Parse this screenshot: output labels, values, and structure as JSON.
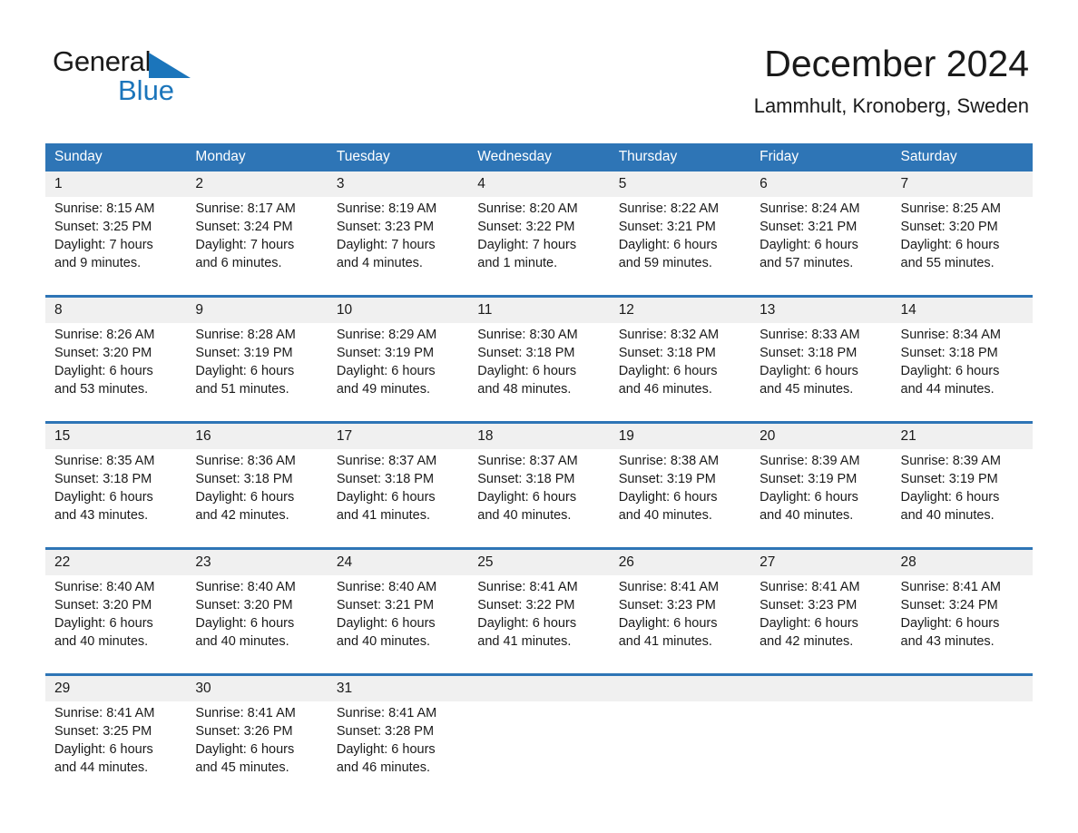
{
  "brand": {
    "name_part1": "General",
    "name_part2": "Blue",
    "accent_color": "#1b75bb",
    "triangle_icon": "blue-triangle-icon"
  },
  "header": {
    "month_title": "December 2024",
    "location": "Lammhult, Kronoberg, Sweden"
  },
  "calendar": {
    "header_color": "#2e75b6",
    "daynum_bg": "#f0f0f0",
    "weekday_headers": [
      "Sunday",
      "Monday",
      "Tuesday",
      "Wednesday",
      "Thursday",
      "Friday",
      "Saturday"
    ],
    "weeks": [
      {
        "days": [
          {
            "num": "1",
            "l1": "Sunrise: 8:15 AM",
            "l2": "Sunset: 3:25 PM",
            "l3": "Daylight: 7 hours",
            "l4": "and 9 minutes."
          },
          {
            "num": "2",
            "l1": "Sunrise: 8:17 AM",
            "l2": "Sunset: 3:24 PM",
            "l3": "Daylight: 7 hours",
            "l4": "and 6 minutes."
          },
          {
            "num": "3",
            "l1": "Sunrise: 8:19 AM",
            "l2": "Sunset: 3:23 PM",
            "l3": "Daylight: 7 hours",
            "l4": "and 4 minutes."
          },
          {
            "num": "4",
            "l1": "Sunrise: 8:20 AM",
            "l2": "Sunset: 3:22 PM",
            "l3": "Daylight: 7 hours",
            "l4": "and 1 minute."
          },
          {
            "num": "5",
            "l1": "Sunrise: 8:22 AM",
            "l2": "Sunset: 3:21 PM",
            "l3": "Daylight: 6 hours",
            "l4": "and 59 minutes."
          },
          {
            "num": "6",
            "l1": "Sunrise: 8:24 AM",
            "l2": "Sunset: 3:21 PM",
            "l3": "Daylight: 6 hours",
            "l4": "and 57 minutes."
          },
          {
            "num": "7",
            "l1": "Sunrise: 8:25 AM",
            "l2": "Sunset: 3:20 PM",
            "l3": "Daylight: 6 hours",
            "l4": "and 55 minutes."
          }
        ]
      },
      {
        "days": [
          {
            "num": "8",
            "l1": "Sunrise: 8:26 AM",
            "l2": "Sunset: 3:20 PM",
            "l3": "Daylight: 6 hours",
            "l4": "and 53 minutes."
          },
          {
            "num": "9",
            "l1": "Sunrise: 8:28 AM",
            "l2": "Sunset: 3:19 PM",
            "l3": "Daylight: 6 hours",
            "l4": "and 51 minutes."
          },
          {
            "num": "10",
            "l1": "Sunrise: 8:29 AM",
            "l2": "Sunset: 3:19 PM",
            "l3": "Daylight: 6 hours",
            "l4": "and 49 minutes."
          },
          {
            "num": "11",
            "l1": "Sunrise: 8:30 AM",
            "l2": "Sunset: 3:18 PM",
            "l3": "Daylight: 6 hours",
            "l4": "and 48 minutes."
          },
          {
            "num": "12",
            "l1": "Sunrise: 8:32 AM",
            "l2": "Sunset: 3:18 PM",
            "l3": "Daylight: 6 hours",
            "l4": "and 46 minutes."
          },
          {
            "num": "13",
            "l1": "Sunrise: 8:33 AM",
            "l2": "Sunset: 3:18 PM",
            "l3": "Daylight: 6 hours",
            "l4": "and 45 minutes."
          },
          {
            "num": "14",
            "l1": "Sunrise: 8:34 AM",
            "l2": "Sunset: 3:18 PM",
            "l3": "Daylight: 6 hours",
            "l4": "and 44 minutes."
          }
        ]
      },
      {
        "days": [
          {
            "num": "15",
            "l1": "Sunrise: 8:35 AM",
            "l2": "Sunset: 3:18 PM",
            "l3": "Daylight: 6 hours",
            "l4": "and 43 minutes."
          },
          {
            "num": "16",
            "l1": "Sunrise: 8:36 AM",
            "l2": "Sunset: 3:18 PM",
            "l3": "Daylight: 6 hours",
            "l4": "and 42 minutes."
          },
          {
            "num": "17",
            "l1": "Sunrise: 8:37 AM",
            "l2": "Sunset: 3:18 PM",
            "l3": "Daylight: 6 hours",
            "l4": "and 41 minutes."
          },
          {
            "num": "18",
            "l1": "Sunrise: 8:37 AM",
            "l2": "Sunset: 3:18 PM",
            "l3": "Daylight: 6 hours",
            "l4": "and 40 minutes."
          },
          {
            "num": "19",
            "l1": "Sunrise: 8:38 AM",
            "l2": "Sunset: 3:19 PM",
            "l3": "Daylight: 6 hours",
            "l4": "and 40 minutes."
          },
          {
            "num": "20",
            "l1": "Sunrise: 8:39 AM",
            "l2": "Sunset: 3:19 PM",
            "l3": "Daylight: 6 hours",
            "l4": "and 40 minutes."
          },
          {
            "num": "21",
            "l1": "Sunrise: 8:39 AM",
            "l2": "Sunset: 3:19 PM",
            "l3": "Daylight: 6 hours",
            "l4": "and 40 minutes."
          }
        ]
      },
      {
        "days": [
          {
            "num": "22",
            "l1": "Sunrise: 8:40 AM",
            "l2": "Sunset: 3:20 PM",
            "l3": "Daylight: 6 hours",
            "l4": "and 40 minutes."
          },
          {
            "num": "23",
            "l1": "Sunrise: 8:40 AM",
            "l2": "Sunset: 3:20 PM",
            "l3": "Daylight: 6 hours",
            "l4": "and 40 minutes."
          },
          {
            "num": "24",
            "l1": "Sunrise: 8:40 AM",
            "l2": "Sunset: 3:21 PM",
            "l3": "Daylight: 6 hours",
            "l4": "and 40 minutes."
          },
          {
            "num": "25",
            "l1": "Sunrise: 8:41 AM",
            "l2": "Sunset: 3:22 PM",
            "l3": "Daylight: 6 hours",
            "l4": "and 41 minutes."
          },
          {
            "num": "26",
            "l1": "Sunrise: 8:41 AM",
            "l2": "Sunset: 3:23 PM",
            "l3": "Daylight: 6 hours",
            "l4": "and 41 minutes."
          },
          {
            "num": "27",
            "l1": "Sunrise: 8:41 AM",
            "l2": "Sunset: 3:23 PM",
            "l3": "Daylight: 6 hours",
            "l4": "and 42 minutes."
          },
          {
            "num": "28",
            "l1": "Sunrise: 8:41 AM",
            "l2": "Sunset: 3:24 PM",
            "l3": "Daylight: 6 hours",
            "l4": "and 43 minutes."
          }
        ]
      },
      {
        "days": [
          {
            "num": "29",
            "l1": "Sunrise: 8:41 AM",
            "l2": "Sunset: 3:25 PM",
            "l3": "Daylight: 6 hours",
            "l4": "and 44 minutes."
          },
          {
            "num": "30",
            "l1": "Sunrise: 8:41 AM",
            "l2": "Sunset: 3:26 PM",
            "l3": "Daylight: 6 hours",
            "l4": "and 45 minutes."
          },
          {
            "num": "31",
            "l1": "Sunrise: 8:41 AM",
            "l2": "Sunset: 3:28 PM",
            "l3": "Daylight: 6 hours",
            "l4": "and 46 minutes."
          },
          {
            "num": "",
            "l1": "",
            "l2": "",
            "l3": "",
            "l4": ""
          },
          {
            "num": "",
            "l1": "",
            "l2": "",
            "l3": "",
            "l4": ""
          },
          {
            "num": "",
            "l1": "",
            "l2": "",
            "l3": "",
            "l4": ""
          },
          {
            "num": "",
            "l1": "",
            "l2": "",
            "l3": "",
            "l4": ""
          }
        ]
      }
    ]
  }
}
